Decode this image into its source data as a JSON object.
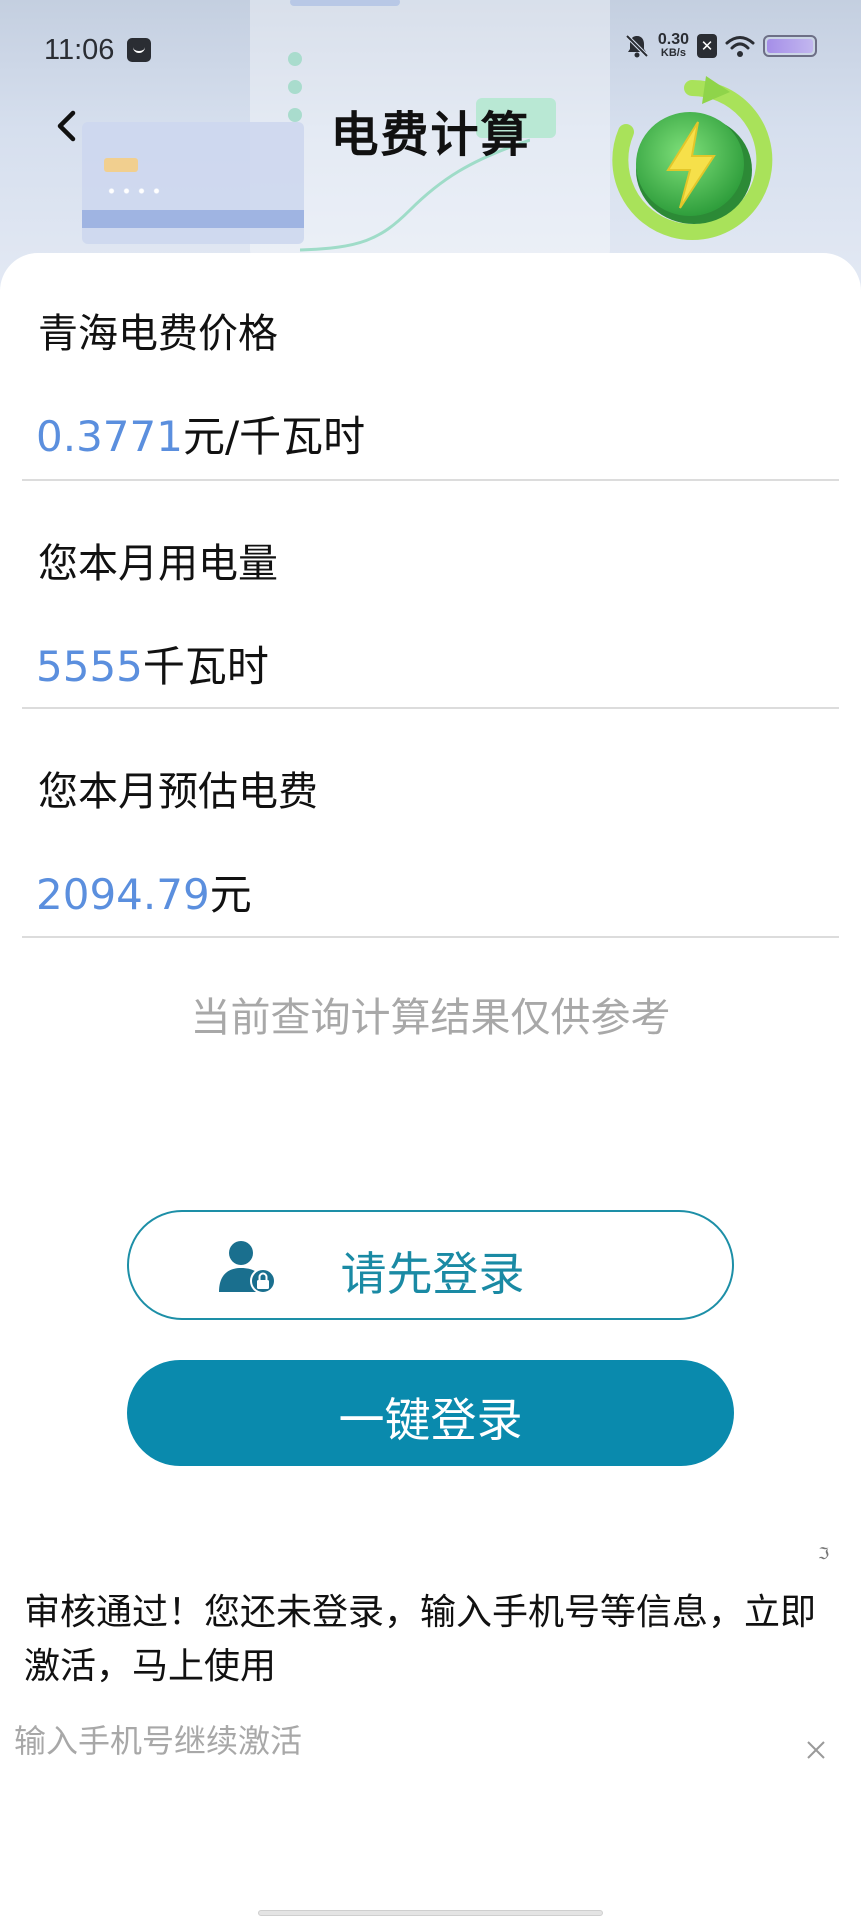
{
  "status_bar": {
    "time": "11:06",
    "net_speed_value": "0.30",
    "net_speed_unit": "KB/s",
    "icons": [
      "message-icon",
      "mute-bell-icon",
      "sim-blocked-icon",
      "wifi-icon",
      "battery-icon"
    ]
  },
  "header": {
    "title": "电费计算",
    "back_icon": "chevron-left-icon",
    "badge_icon": "lightning-bolt-icon"
  },
  "rows": [
    {
      "label": "青海电费价格",
      "value_number": "0.3771",
      "value_unit": "元/千瓦时"
    },
    {
      "label": "您本月用电量",
      "value_number": "5555",
      "value_unit": "千瓦时"
    },
    {
      "label": "您本月预估电费",
      "value_number": "2094.79",
      "value_unit": "元"
    }
  ],
  "disclaimer": "当前查询计算结果仅供参考",
  "buttons": {
    "login_prompt": "请先登录",
    "one_click_login": "一键登录"
  },
  "notice": {
    "text": "审核通过！您还未登录，输入手机号等信息，立即激活，马上使用",
    "input_hint": "输入手机号继续激活"
  },
  "colors": {
    "value_blue": "#5b8fde",
    "primary_teal": "#0a8aad",
    "outline_teal": "#1d8fa7",
    "hint_gray": "#a8a8a8"
  }
}
